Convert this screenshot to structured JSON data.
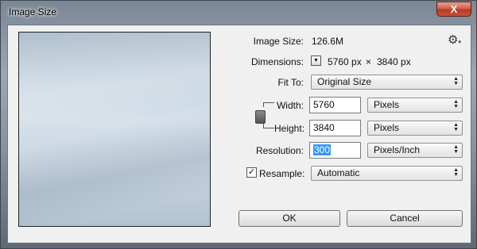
{
  "window": {
    "title": "Image Size",
    "close_glyph": "X"
  },
  "info": {
    "image_size_label": "Image Size:",
    "image_size_value": "126.6M",
    "dimensions_label": "Dimensions:",
    "dimensions_width": "5760 px",
    "dimensions_x": "×",
    "dimensions_height": "3840 px"
  },
  "fit_to": {
    "label": "Fit To:",
    "value": "Original Size"
  },
  "width": {
    "label": "Width:",
    "value": "5760",
    "unit": "Pixels"
  },
  "height": {
    "label": "Height:",
    "value": "3840",
    "unit": "Pixels"
  },
  "resolution": {
    "label": "Resolution:",
    "value": "300",
    "unit": "Pixels/Inch"
  },
  "resample": {
    "label": "Resample:",
    "checked": true,
    "value": "Automatic"
  },
  "buttons": {
    "ok": "OK",
    "cancel": "Cancel"
  },
  "icons": {
    "settings": "gear-icon",
    "constrain": "chain-link-icon",
    "dropdown": "triangle-down-icon"
  }
}
